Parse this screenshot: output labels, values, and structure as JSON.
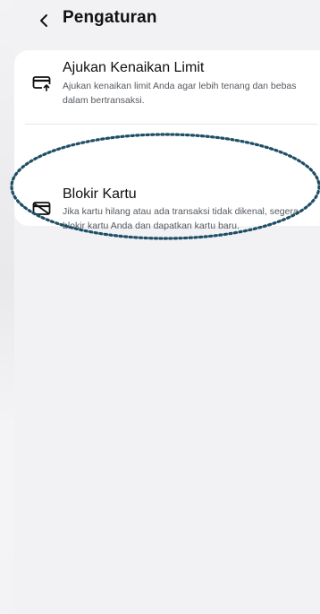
{
  "header": {
    "back_icon": "chevron-left-icon",
    "title": "Pengaturan"
  },
  "settings": {
    "items": [
      {
        "icon": "card-arrow-up-icon",
        "title": "Ajukan Kenaikan Limit",
        "description": "Ajukan kenaikan limit Anda agar lebih tenang dan bebas dalam bertransaksi."
      },
      {
        "icon": "card-block-icon",
        "title": "Blokir Kartu",
        "description": "Jika kartu hilang atau ada transaksi tidak dikenal, segera blokir kartu Anda dan dapatkan kartu baru."
      }
    ]
  },
  "colors": {
    "background": "#f2f2f4",
    "card": "#ffffff",
    "highlight": "#1f4f66"
  }
}
